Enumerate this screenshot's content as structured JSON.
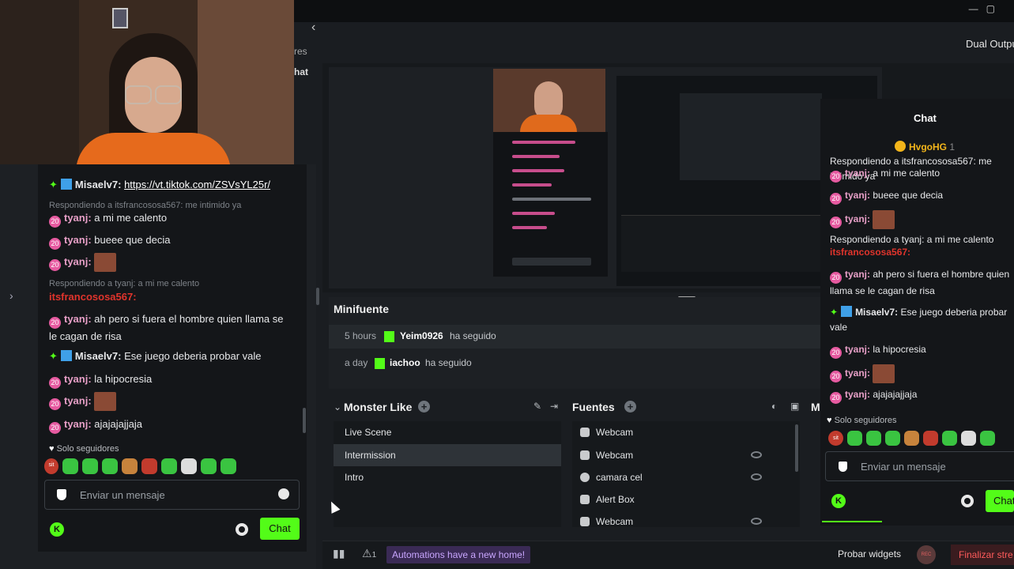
{
  "left_chat": {
    "line1": {
      "user": "Misaelv7:",
      "link": "https://vt.tiktok.com/ZSVsYL25r/"
    },
    "line2_reply": "Respondiendo a itsfrancososa567: me intimido ya",
    "line3": {
      "user": "tyanj:",
      "text": "a mi me calento"
    },
    "line4": {
      "user": "tyanj:",
      "text": "bueee que decia"
    },
    "line5": {
      "user": "tyanj:"
    },
    "line6_reply": "Respondiendo a tyanj: a mi me calento",
    "line7": {
      "user": "itsfrancososa567:"
    },
    "line8": {
      "user": "tyanj:",
      "text": "ah pero si fuera el hombre quien llama se le cagan de risa"
    },
    "line9": {
      "user": "Misaelv7:",
      "text": "Ese juego deberia probar vale"
    },
    "line10": {
      "user": "tyanj:",
      "text": "la hipocresia"
    },
    "line11": {
      "user": "tyanj:"
    },
    "line12": {
      "user": "tyanj:",
      "text": "ajajajajjaja"
    },
    "followers_only": "Solo seguidores",
    "input_placeholder": "Enviar un mensaje",
    "chat_button": "Chat"
  },
  "top": {
    "cut_text_1": "res",
    "cut_text_2": "hat",
    "dual_output": "Dual Outpu"
  },
  "right_chat": {
    "title": "Chat",
    "pinned_user": "HvgoHG",
    "pinned_count": "1",
    "lines": [
      {
        "kind": "reply",
        "text": "Respondiendo a itsfrancososa567: me intimido ya"
      },
      {
        "kind": "msg",
        "user": "tyanj:",
        "text": "a mi me calento"
      },
      {
        "kind": "msg",
        "user": "tyanj:",
        "text": "bueee que decia"
      },
      {
        "kind": "msg",
        "user": "tyanj:",
        "text": ""
      },
      {
        "kind": "reply",
        "text": "Respondiendo a tyanj: a mi me calento"
      },
      {
        "kind": "red",
        "user": "itsfrancososa567:"
      },
      {
        "kind": "msg",
        "user": "tyanj:",
        "text": "ah pero si fuera el hombre quien llama se le cagan de risa"
      },
      {
        "kind": "kick",
        "user": "Misaelv7:",
        "text": "Ese juego deberia probar vale"
      },
      {
        "kind": "msg",
        "user": "tyanj:",
        "text": "la hipocresia"
      },
      {
        "kind": "msg",
        "user": "tyanj:",
        "text": ""
      },
      {
        "kind": "msg",
        "user": "tyanj:",
        "text": "ajajajajjaja"
      }
    ],
    "followers_only": "Solo seguidores",
    "input_placeholder": "Enviar un mensaje",
    "chat_button": "Chat"
  },
  "minifuente": {
    "title": "Minifuente",
    "events": [
      {
        "time": "5 hours",
        "user": "Yeim0926",
        "action": "ha seguido"
      },
      {
        "time": "a day",
        "user": "iachoo",
        "action": "ha seguido"
      }
    ]
  },
  "scenes": {
    "title": "Monster Like",
    "items": [
      "Live Scene",
      "Intermission",
      "Intro"
    ],
    "selected_index": 1
  },
  "sources": {
    "title": "Fuentes",
    "items": [
      "Webcam",
      "Webcam",
      "camara cel",
      "Alert Box",
      "Webcam"
    ],
    "third_panel_letter": "M"
  },
  "status": {
    "alert_count": "1",
    "automations": "Automations have a new home!",
    "probar": "Probar widgets",
    "rec": "REC",
    "finalizar": "Finalizar stre"
  },
  "colors": {
    "kick_green": "#53fc18",
    "tyanj_pink": "#e65aa0",
    "red_user": "#e0342c",
    "automations_purple": "#c9a6ff"
  }
}
